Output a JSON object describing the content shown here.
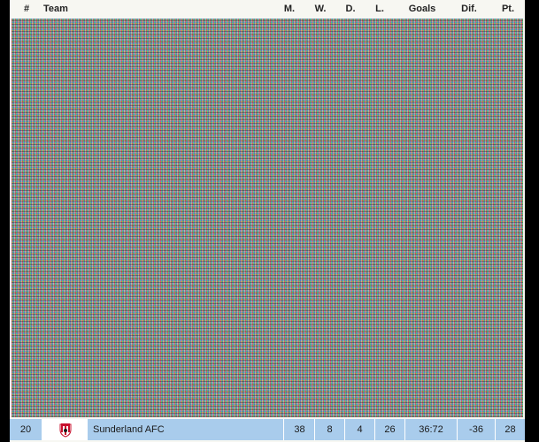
{
  "table": {
    "headers": {
      "rank": "#",
      "team": "Team",
      "matches": "M.",
      "wins": "W.",
      "draws": "D.",
      "losses": "L.",
      "goals": "Goals",
      "diff": "Dif.",
      "points": "Pt."
    },
    "rows": [
      {
        "rank": "20",
        "team": "Sunderland AFC",
        "logo_icon": "sunderland-crest-icon",
        "matches": "38",
        "wins": "8",
        "draws": "4",
        "losses": "26",
        "goals": "36:72",
        "diff": "-36",
        "points": "28"
      }
    ]
  },
  "colors": {
    "highlight_row": "#a9ccec",
    "header_bg": "#f7f7f2"
  }
}
